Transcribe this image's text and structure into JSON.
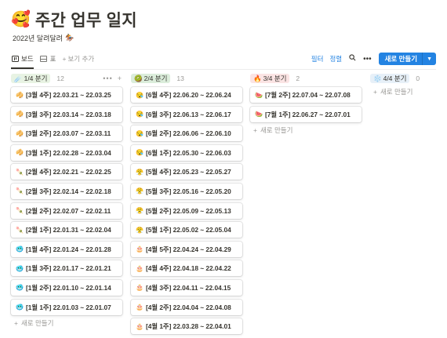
{
  "page": {
    "title_emoji": "🥰",
    "title": "주간 업무 일지",
    "subtitle": "2022년 달려달려",
    "subtitle_emoji": "🏇"
  },
  "toolbar": {
    "views": [
      {
        "label": "보드",
        "icon": "board-icon",
        "active": true
      },
      {
        "label": "표",
        "icon": "table-icon",
        "active": false
      }
    ],
    "add_view_label": "보기 추가",
    "filter_label": "필터",
    "sort_label": "정렬",
    "new_button_label": "새로 만들기",
    "accent_color": "#2383e2"
  },
  "board": {
    "add_new_label": "새로 만들기",
    "columns": [
      {
        "label": "1/4 분기",
        "emoji": "☄️",
        "color": "#e8f3e3",
        "count": "12",
        "cards": [
          {
            "emoji": "🥠",
            "text": "[3월 4주] 22.03.21 ~ 22.03.25"
          },
          {
            "emoji": "🥠",
            "text": "[3월 3주] 22.03.14 ~ 22.03.18"
          },
          {
            "emoji": "🥠",
            "text": "[3월 2주] 22.03.07 ~ 22.03.11"
          },
          {
            "emoji": "🥠",
            "text": "[3월 1주] 22.02.28 ~ 22.03.04"
          },
          {
            "emoji": "🍡",
            "text": "[2월 4주] 22.02.21 ~ 22.02.25"
          },
          {
            "emoji": "🍡",
            "text": "[2월 3주] 22.02.14 ~ 22.02.18"
          },
          {
            "emoji": "🍡",
            "text": "[2월 2주] 22.02.07 ~ 22.02.11"
          },
          {
            "emoji": "🍡",
            "text": "[2월 1주] 22.01.31 ~ 22.02.04"
          },
          {
            "emoji": "🥶",
            "text": "[1월 4주] 22.01.24 ~ 22.01.28"
          },
          {
            "emoji": "🥶",
            "text": "[1월 3주] 22.01.17 ~ 22.01.21"
          },
          {
            "emoji": "🥶",
            "text": "[1월 2주] 22.01.10 ~ 22.01.14"
          },
          {
            "emoji": "🥶",
            "text": "[1월 1주] 22.01.03 ~ 22.01.07"
          }
        ]
      },
      {
        "label": "2/4 분기",
        "emoji": "🥝",
        "color": "#dbeddb",
        "count": "13",
        "cards": [
          {
            "emoji": "😪",
            "text": "[6월 4주] 22.06.20 ~ 22.06.24"
          },
          {
            "emoji": "😪",
            "text": "[6월 3주] 22.06.13 ~ 22.06.17"
          },
          {
            "emoji": "😪",
            "text": "[6월 2주] 22.06.06 ~ 22.06.10"
          },
          {
            "emoji": "😪",
            "text": "[6월 1주] 22.05.30 ~ 22.06.03"
          },
          {
            "emoji": "😤",
            "text": "[5월 4주] 22.05.23 ~ 22.05.27"
          },
          {
            "emoji": "😤",
            "text": "[5월 3주] 22.05.16 ~ 22.05.20"
          },
          {
            "emoji": "😤",
            "text": "[5월 2주] 22.05.09 ~ 22.05.13"
          },
          {
            "emoji": "😤",
            "text": "[5월 1주] 22.05.02 ~ 22.05.04"
          },
          {
            "emoji": "🎂",
            "text": "[4월 5주] 22.04.24 ~ 22.04.29"
          },
          {
            "emoji": "🎂",
            "text": "[4월 4주] 22.04.18 ~ 22.04.22"
          },
          {
            "emoji": "🎂",
            "text": "[4월 3주] 22.04.11 ~ 22.04.15"
          },
          {
            "emoji": "🎂",
            "text": "[4월 2주] 22.04.04 ~ 22.04.08"
          },
          {
            "emoji": "🎂",
            "text": "[4월 1주] 22.03.28 ~ 22.04.01"
          }
        ]
      },
      {
        "label": "3/4 분기",
        "emoji": "🔥",
        "color": "#fbe4e4",
        "count": "2",
        "cards": [
          {
            "emoji": "🍉",
            "text": "[7월 2주] 22.07.04 ~ 22.07.08"
          },
          {
            "emoji": "🍉",
            "text": "[7월 1주] 22.06.27 ~ 22.07.01"
          }
        ]
      },
      {
        "label": "4/4 분기",
        "emoji": "❄️",
        "color": "#e7f0f8",
        "count": "0",
        "cards": []
      }
    ]
  }
}
